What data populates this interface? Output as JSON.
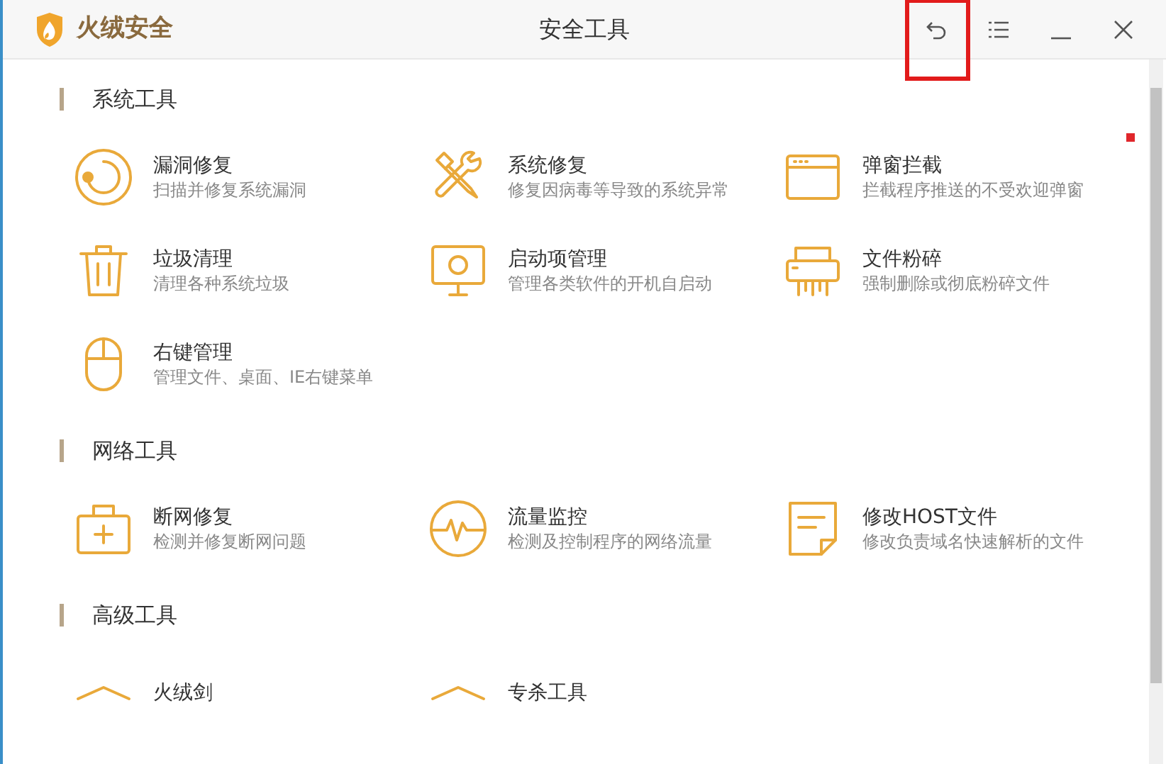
{
  "window": {
    "app_name": "火绒安全",
    "title": "安全工具",
    "back_button_highlighted": true
  },
  "notification_dot": true,
  "sections": [
    {
      "title": "系统工具",
      "items": [
        {
          "name": "漏洞修复",
          "description": "扫描并修复系统漏洞"
        },
        {
          "name": "系统修复",
          "description": "修复因病毒等导致的系统异常"
        },
        {
          "name": "弹窗拦截",
          "description": "拦截程序推送的不受欢迎弹窗"
        },
        {
          "name": "垃圾清理",
          "description": "清理各种系统垃圾"
        },
        {
          "name": "启动项管理",
          "description": "管理各类软件的开机自启动"
        },
        {
          "name": "文件粉碎",
          "description": "强制删除或彻底粉碎文件"
        },
        {
          "name": "右键管理",
          "description": "管理文件、桌面、IE右键菜单"
        }
      ]
    },
    {
      "title": "网络工具",
      "items": [
        {
          "name": "断网修复",
          "description": "检测并修复断网问题"
        },
        {
          "name": "流量监控",
          "description": "检测及控制程序的网络流量"
        },
        {
          "name": "修改HOST文件",
          "description": "修改负责域名快速解析的文件"
        }
      ]
    },
    {
      "title": "高级工具",
      "items": [
        {
          "name": "火绒剑"
        },
        {
          "name": "专杀工具"
        }
      ]
    }
  ]
}
